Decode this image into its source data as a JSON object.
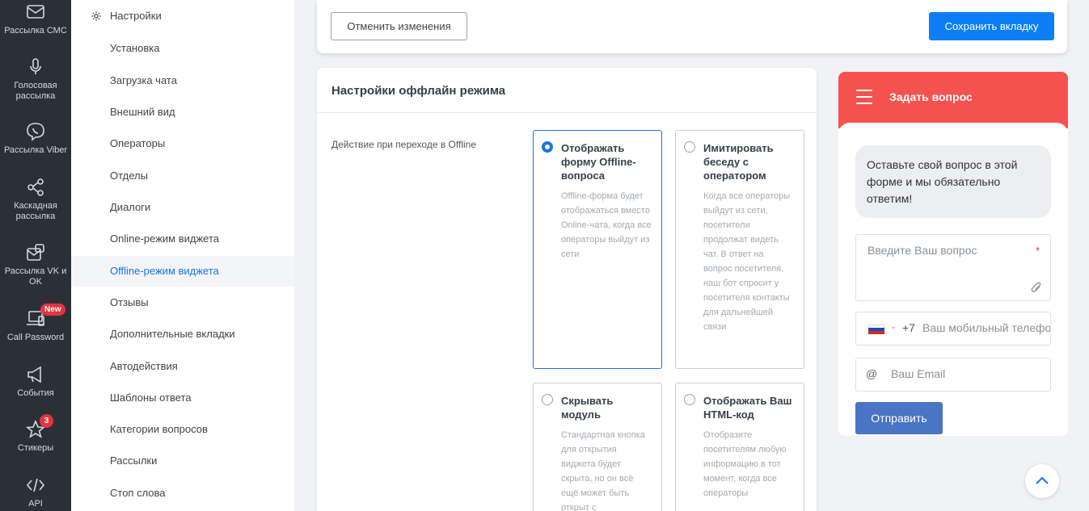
{
  "sidebar": {
    "items": [
      {
        "label": "Рассылка СМС",
        "icon": "envelope-icon"
      },
      {
        "label": "Голосовая рассылка",
        "icon": "microphone-icon"
      },
      {
        "label": "Рассылка Viber",
        "icon": "viber-icon"
      },
      {
        "label": "Каскадная рассылка",
        "icon": "share-icon"
      },
      {
        "label": "Рассылка VK и OK",
        "icon": "vk-ok-icon"
      },
      {
        "label": "Call Password",
        "icon": "devices-icon",
        "badge": "New"
      },
      {
        "label": "События",
        "icon": "megaphone-icon"
      },
      {
        "label": "Стикеры",
        "icon": "star-icon",
        "badge": "3"
      },
      {
        "label": "API",
        "icon": "code-icon"
      }
    ]
  },
  "menu": {
    "header": "Настройки",
    "items": [
      "Установка",
      "Загрузка чата",
      "Внешний вид",
      "Операторы",
      "Отделы",
      "Диалоги",
      "Online-режим виджета",
      "Offline-режим виджета",
      "Отзывы",
      "Дополнительные вкладки",
      "Автодействия",
      "Шаблоны ответа",
      "Категории вопросов",
      "Рассылки",
      "Стоп слова"
    ],
    "active_index": 7
  },
  "toolbar": {
    "cancel_label": "Отменить изменения",
    "save_label": "Сохранить вкладку"
  },
  "offline": {
    "title": "Настройки оффлайн режима",
    "field_label": "Действие при переходе в Offline",
    "options": [
      {
        "title": "Отображать форму Offline-вопроса",
        "desc": "Offline-форма будет отображаться вместо Online-чата, когда все операторы выйдут из сети",
        "selected": true
      },
      {
        "title": "Имитировать беседу с оператором",
        "desc": "Когда все операторы выйдут из сети, посетители продолжат видеть чат. В ответ на вопрос посетителя, наш бот спросит у посетителя контакты для дальнейшей связи",
        "selected": false
      },
      {
        "title": "Скрывать модуль",
        "desc": "Стандартная кнопка для открытия виджета будет скрыта, но он всё ещё может быть открыт с",
        "selected": false
      },
      {
        "title": "Отображать Ваш HTML-код",
        "desc": "Отобразите посетителям любую информацию в тот момент, когда все операторы",
        "selected": false
      }
    ]
  },
  "widget": {
    "title": "Задать вопрос",
    "message": "Оставьте свой вопрос в этой форме и мы обязательно ответим!",
    "question_placeholder": "Введите Ваш вопрос",
    "required_mark": "*",
    "country_code": "+7",
    "phone_placeholder": "Ваш мобильный телефон",
    "email_symbol": "@",
    "email_placeholder": "Ваш Email",
    "send_label": "Отправить",
    "header_color": "#f5524f",
    "send_color": "#4a74c4"
  },
  "colors": {
    "accent": "#1a73e8",
    "save_button": "#0d7ef5",
    "rail_bg": "#2b3038"
  }
}
